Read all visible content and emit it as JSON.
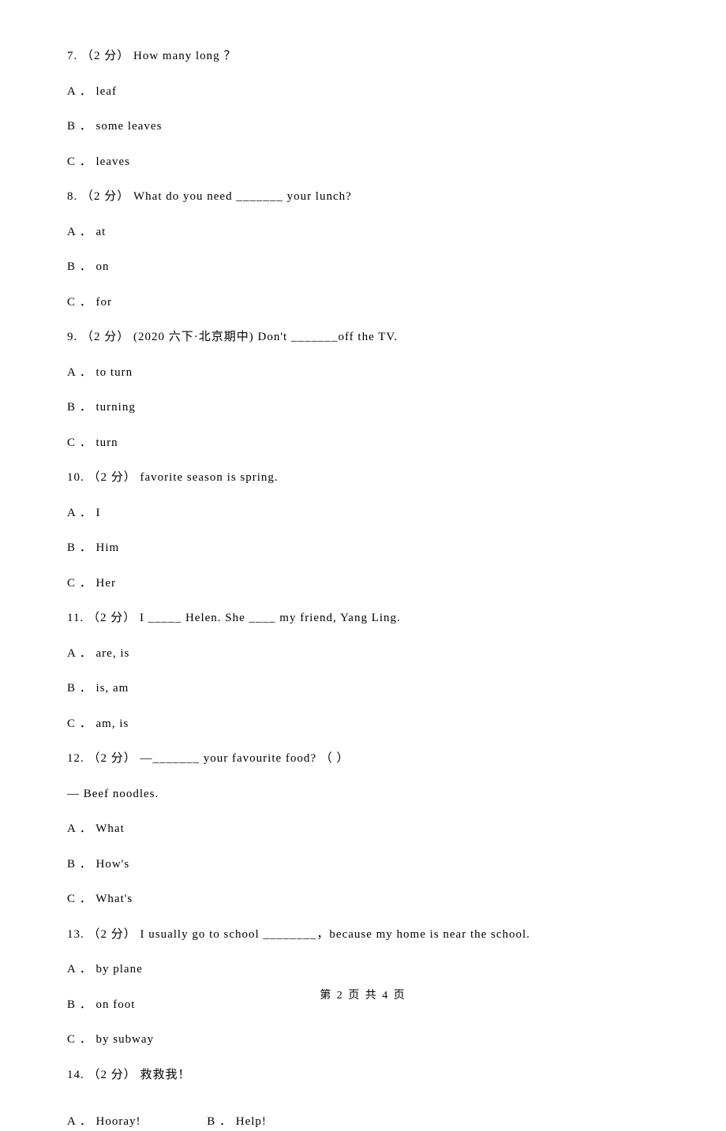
{
  "questions": [
    {
      "number": "7.",
      "points": "（2 分）",
      "text": " How many long           ？",
      "options": [
        {
          "label": "A ．",
          "text": "leaf"
        },
        {
          "label": "B ．",
          "text": "some leaves"
        },
        {
          "label": "C ．",
          "text": "leaves"
        }
      ]
    },
    {
      "number": "8.",
      "points": "（2 分）",
      "text": " What do you need _______ your lunch?",
      "options": [
        {
          "label": "A ．",
          "text": "at"
        },
        {
          "label": "B ．",
          "text": "on"
        },
        {
          "label": "C ．",
          "text": "for"
        }
      ]
    },
    {
      "number": "9.",
      "points": "（2 分）",
      "text": " (2020 六下·北京期中) Don't _______off the TV.",
      "options": [
        {
          "label": "A ．",
          "text": "to turn"
        },
        {
          "label": "B ．",
          "text": "turning"
        },
        {
          "label": "C ．",
          "text": "turn"
        }
      ]
    },
    {
      "number": "10.",
      "points": "（2 分）",
      "text": "             favorite season is spring.",
      "options": [
        {
          "label": "A ．",
          "text": "I"
        },
        {
          "label": "B ．",
          "text": "Him"
        },
        {
          "label": "C ．",
          "text": "Her"
        }
      ]
    },
    {
      "number": "11.",
      "points": "（2 分）",
      "text": " I _____ Helen. She ____ my friend, Yang Ling.",
      "options": [
        {
          "label": "A ．",
          "text": "are, is"
        },
        {
          "label": "B ．",
          "text": "is, am"
        },
        {
          "label": "C ．",
          "text": "am, is"
        }
      ]
    },
    {
      "number": "12.",
      "points": "（2 分）",
      "text": " —_______ your favourite food? （    ）",
      "followup": "— Beef noodles.",
      "options": [
        {
          "label": "A ．",
          "text": "What"
        },
        {
          "label": "B ．",
          "text": "How's"
        },
        {
          "label": "C ．",
          "text": "What's"
        }
      ]
    },
    {
      "number": "13.",
      "points": "（2 分）",
      "text": " I usually go to school ________，because my home is near the school.",
      "options": [
        {
          "label": "A ．",
          "text": "by plane"
        },
        {
          "label": "B ．",
          "text": "on foot"
        },
        {
          "label": "C ．",
          "text": "by subway"
        }
      ]
    },
    {
      "number": "14.",
      "points": "（2 分）",
      "text": " 救救我！",
      "inline_options": [
        {
          "label": "A ．",
          "text": "Hooray!"
        },
        {
          "label": "B ．",
          "text": "Help!"
        }
      ]
    }
  ],
  "footer": "第 2 页 共 4 页"
}
